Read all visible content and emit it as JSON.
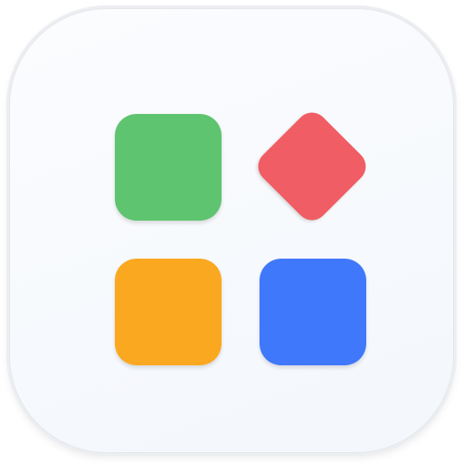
{
  "app_icon": {
    "background": "#f6f9fd",
    "tiles": [
      {
        "name": "green-square-tile",
        "shape": "rounded-square",
        "color": "#5fc46f"
      },
      {
        "name": "red-diamond-tile",
        "shape": "rounded-diamond",
        "color": "#f05d64"
      },
      {
        "name": "orange-square-tile",
        "shape": "rounded-square",
        "color": "#fba821"
      },
      {
        "name": "blue-square-tile",
        "shape": "rounded-square",
        "color": "#3f78fb"
      }
    ]
  }
}
